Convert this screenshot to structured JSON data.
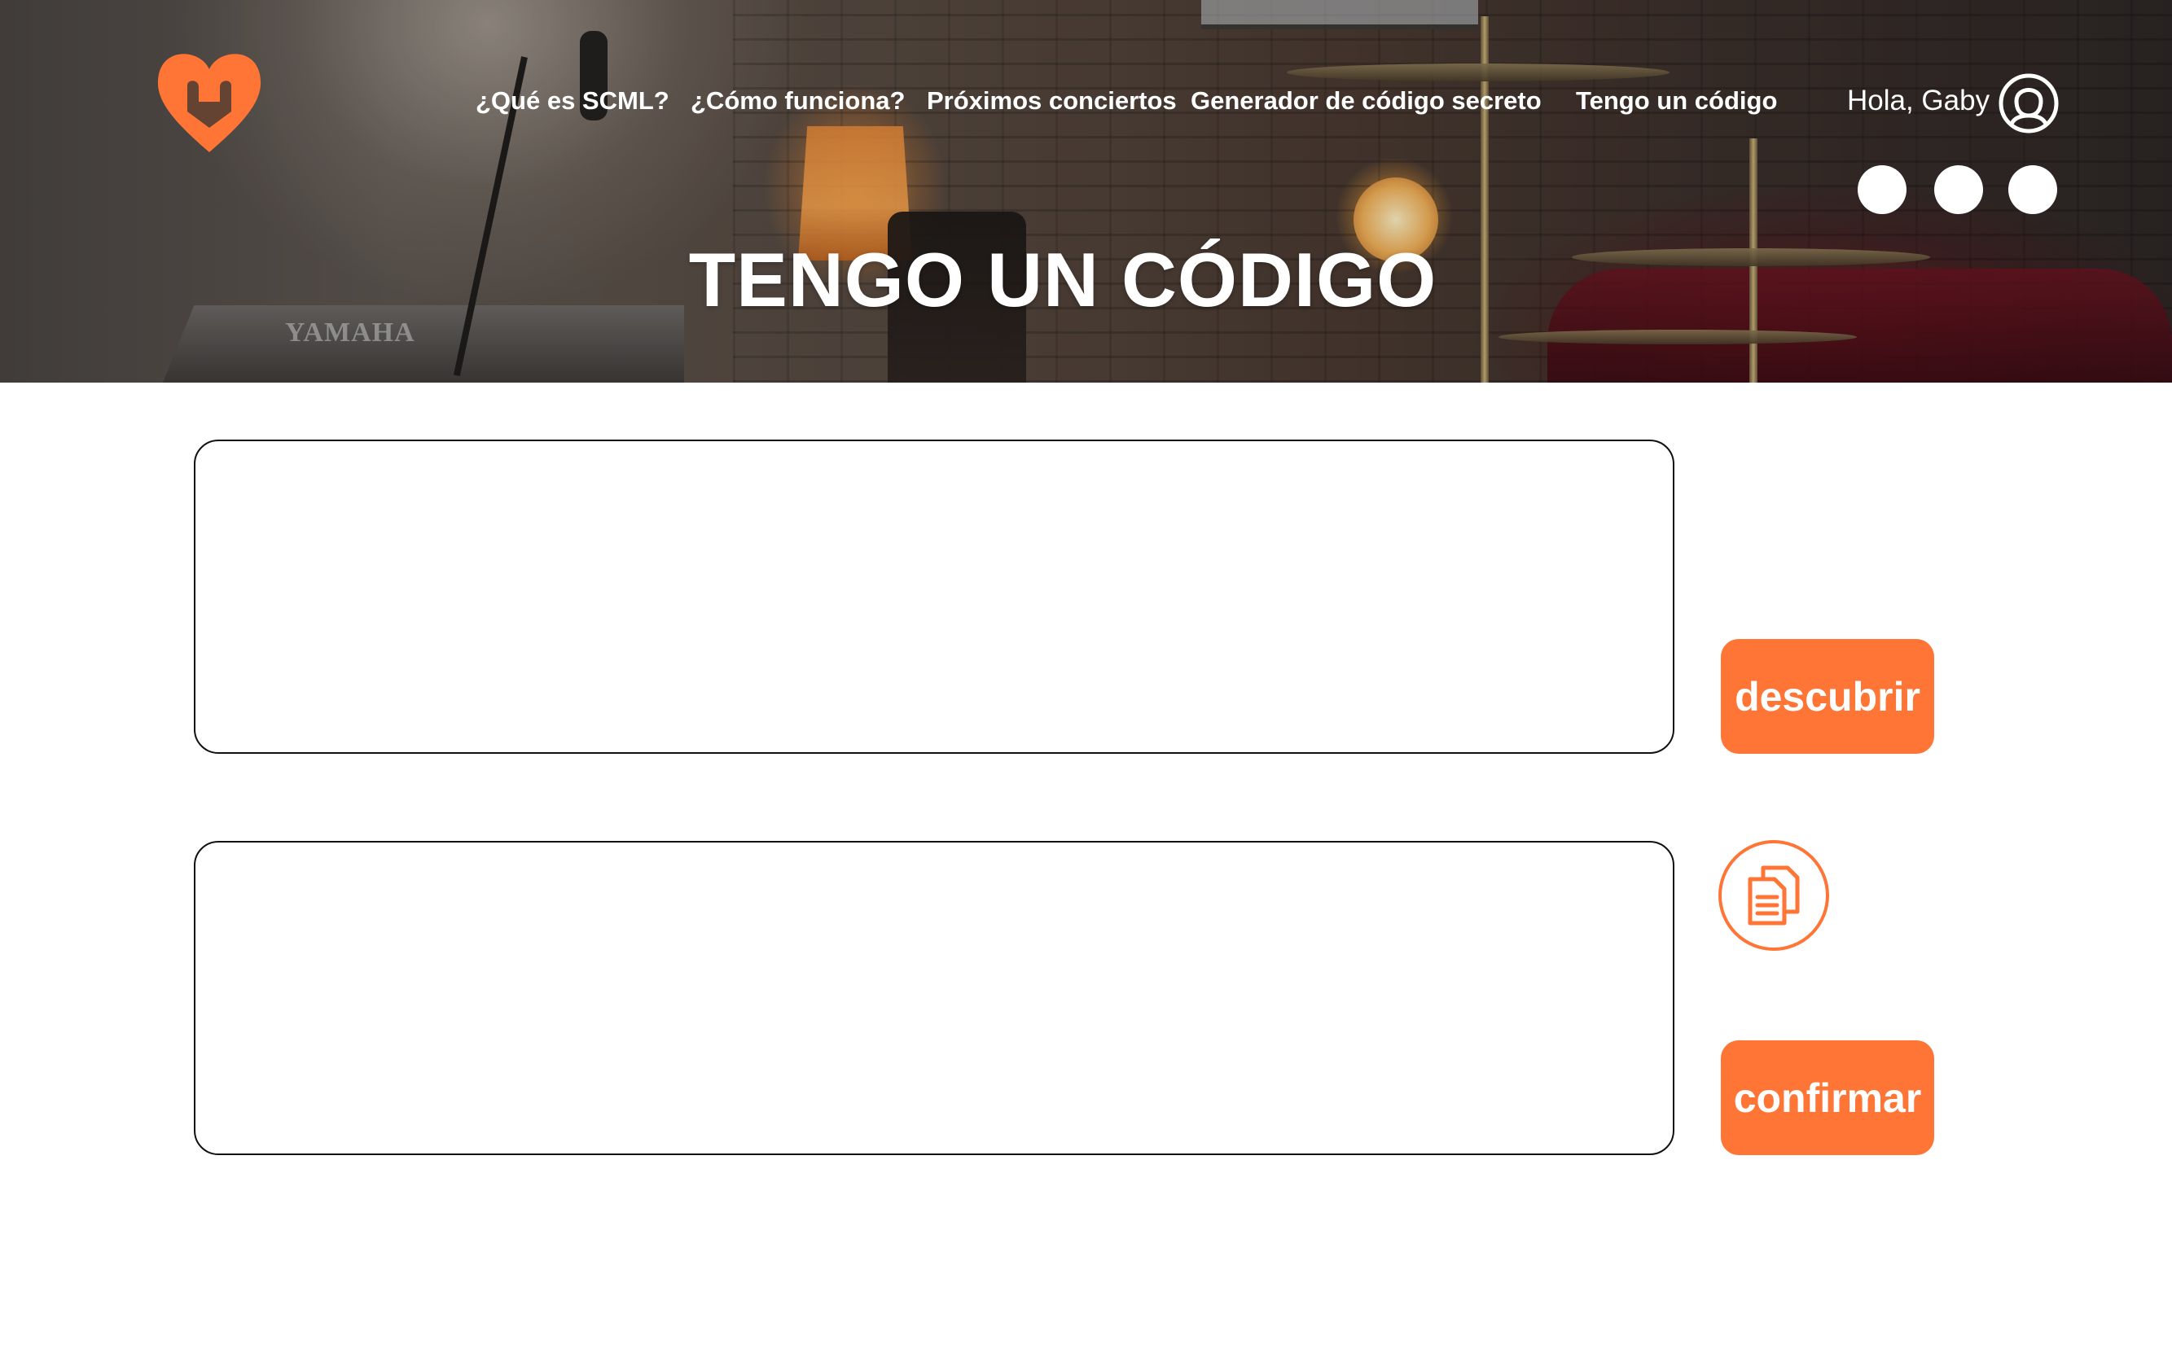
{
  "nav": {
    "items": [
      {
        "label": "¿Qué es SCML?"
      },
      {
        "label": "¿Cómo funciona?"
      },
      {
        "label": "Próximos conciertos"
      },
      {
        "label": "Generador de código secreto"
      },
      {
        "label": "Tengo un código"
      }
    ]
  },
  "user": {
    "greeting": "Hola, Gaby",
    "icon": "user-avatar-icon"
  },
  "hero": {
    "title": "TENGO UN CÓDIGO",
    "keyboard_brand": "YAMAHA"
  },
  "form": {
    "input_value": "",
    "output_value": "",
    "discover_label": "descubrir",
    "confirm_label": "confirmar",
    "copy_icon": "copy-document-icon"
  },
  "colors": {
    "accent": "#fe7536",
    "text_light": "#ffffff",
    "border": "#111111"
  }
}
